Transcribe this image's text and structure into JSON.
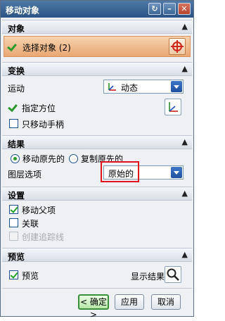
{
  "window": {
    "title": "移动对象"
  },
  "sections": {
    "object": {
      "title": "对象",
      "select_label": "选择对象 (2)"
    },
    "transform": {
      "title": "变换",
      "motion_label": "运动",
      "motion_value": "动态",
      "orient_label": "指定方位",
      "move_handle_label": "只移动手柄",
      "move_handle_checked": false
    },
    "result": {
      "title": "结果",
      "radio_move": "移动原先的",
      "radio_copy": "复制原先的",
      "layer_label": "图层选项",
      "layer_value": "原始的"
    },
    "settings": {
      "title": "设置",
      "move_parent": "移动父项",
      "move_parent_checked": true,
      "associate": "关联",
      "associate_checked": false,
      "trace": "创建追踪线",
      "trace_enabled": false
    },
    "preview": {
      "title": "预览",
      "preview_label": "预览",
      "preview_checked": true,
      "show_result": "显示结果"
    }
  },
  "buttons": {
    "ok": "< 确定 >",
    "apply": "应用",
    "cancel": "取消"
  },
  "colors": {
    "title_bar": "#2b5485",
    "highlight": "#e0141c",
    "select_row": "#e9a772"
  },
  "icons": [
    "reset-icon",
    "minimize-icon",
    "close-icon",
    "crosshair-icon",
    "motion-axis-icon",
    "orientation-axis-icon",
    "magnifier-icon",
    "collapse-arrow-icon"
  ]
}
